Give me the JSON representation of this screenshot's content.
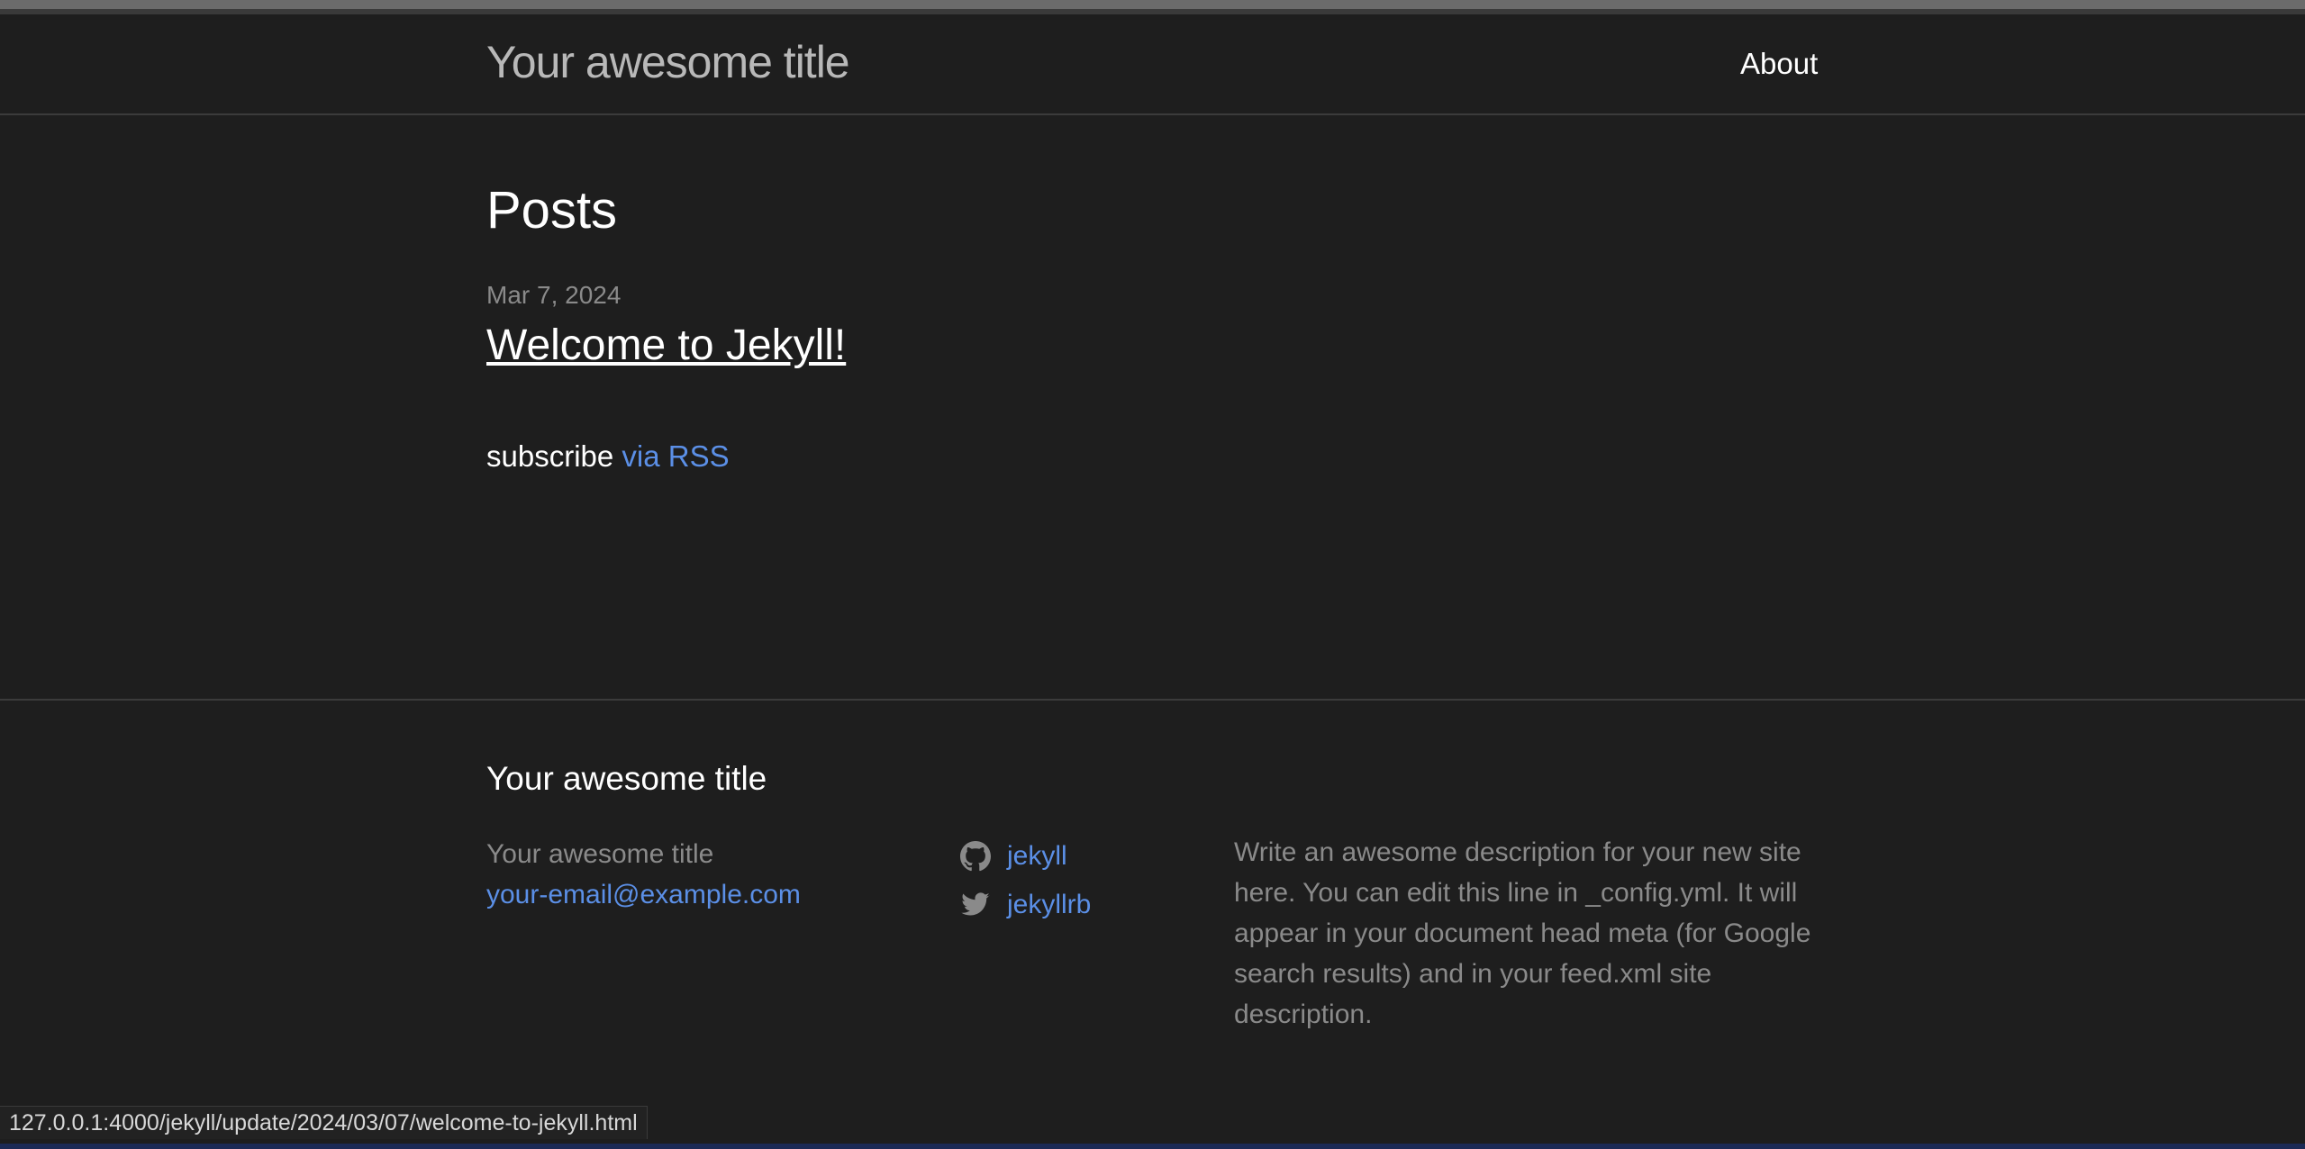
{
  "header": {
    "site_title": "Your awesome title",
    "nav": [
      {
        "label": "About"
      }
    ]
  },
  "main": {
    "heading": "Posts",
    "posts": [
      {
        "date": "Mar 7, 2024",
        "title": "Welcome to Jekyll!"
      }
    ],
    "rss": {
      "prefix": "subscribe",
      "link_label": "via RSS"
    }
  },
  "footer": {
    "heading": "Your awesome title",
    "name": "Your awesome title",
    "email": "your-email@example.com",
    "social": [
      {
        "icon": "github-icon",
        "label": "jekyll"
      },
      {
        "icon": "twitter-icon",
        "label": "jekyllrb"
      }
    ],
    "description": "Write an awesome description for your new site here. You can edit this line in _config.yml. It will appear in your document head meta (for Google search results) and in your feed.xml site description."
  },
  "status_bar": {
    "url": "127.0.0.1:4000/jekyll/update/2024/03/07/welcome-to-jekyll.html"
  },
  "colors": {
    "background": "#1e1e1e",
    "link": "#5b8fe6",
    "text": "#ffffff",
    "muted": "#8a8a8a"
  }
}
